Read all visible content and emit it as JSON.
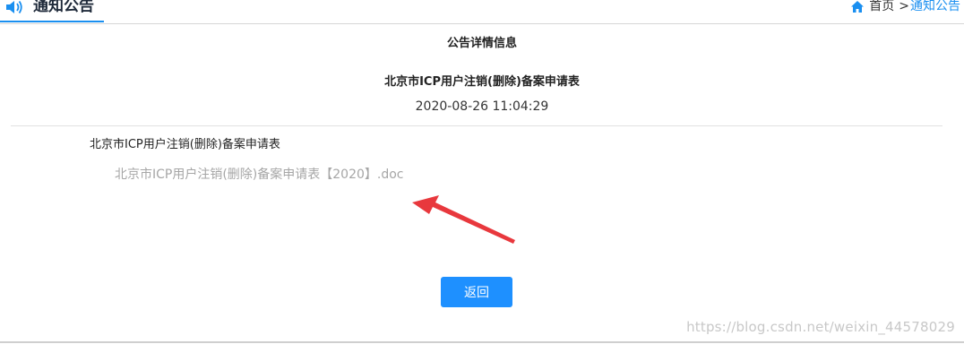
{
  "header": {
    "tab_title": "通知公告",
    "breadcrumb": {
      "home": "首页",
      "separator": ">",
      "current": "通知公告"
    }
  },
  "detail": {
    "heading": "公告详情信息",
    "title": "北京市ICP用户注销(删除)备案申请表",
    "date": "2020-08-26 11:04:29",
    "content_title": "北京市ICP用户注销(删除)备案申请表",
    "attachment": "北京市ICP用户注销(删除)备案申请表【2020】.doc"
  },
  "actions": {
    "back_label": "返回"
  },
  "watermark": "https://blog.csdn.net/weixin_44578029",
  "icons": {
    "tab": "speaker-icon",
    "breadcrumb": "home-icon",
    "annotation": "red-arrow-icon"
  },
  "colors": {
    "accent": "#1a8ff0",
    "button": "#1e90ff",
    "arrow": "#e8383d",
    "attachment_text": "#a6a6a6"
  }
}
